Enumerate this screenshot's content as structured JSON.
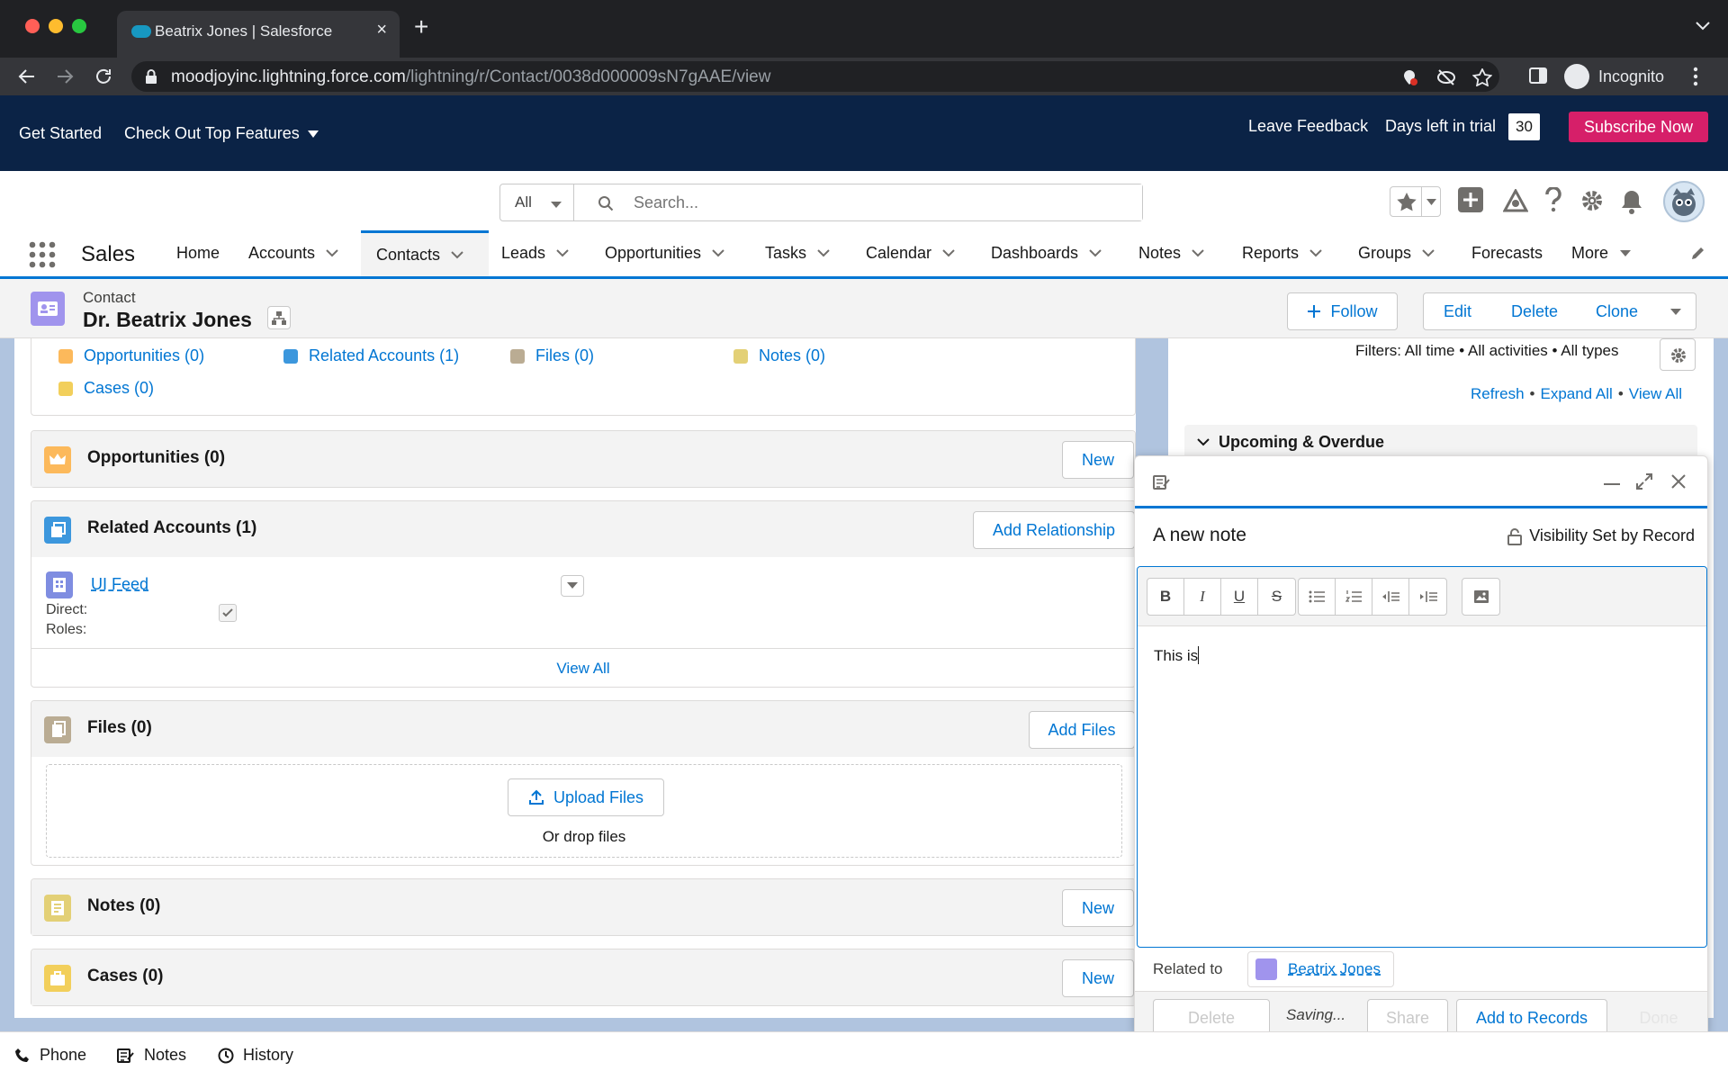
{
  "browser": {
    "tab_title": "Beatrix Jones | Salesforce",
    "url_host": "moodjoyinc.lightning.force.com",
    "url_path": "/lightning/r/Contact/0038d000009sN7gAAE/view",
    "profile_label": "Incognito"
  },
  "banner": {
    "get_started": "Get Started",
    "top_features": "Check Out Top Features",
    "leave_feedback": "Leave Feedback",
    "days_left_label": "Days left in trial",
    "days_left": "30",
    "subscribe": "Subscribe Now"
  },
  "search": {
    "scope": "All",
    "placeholder": "Search..."
  },
  "app": {
    "name": "Sales"
  },
  "nav": {
    "items": [
      {
        "label": "Home",
        "menu": false
      },
      {
        "label": "Accounts",
        "menu": true
      },
      {
        "label": "Contacts",
        "menu": true,
        "active": true
      },
      {
        "label": "Leads",
        "menu": true
      },
      {
        "label": "Opportunities",
        "menu": true
      },
      {
        "label": "Tasks",
        "menu": true
      },
      {
        "label": "Calendar",
        "menu": true
      },
      {
        "label": "Dashboards",
        "menu": true
      },
      {
        "label": "Notes",
        "menu": true
      },
      {
        "label": "Reports",
        "menu": true
      },
      {
        "label": "Groups",
        "menu": true
      },
      {
        "label": "Forecasts",
        "menu": false
      },
      {
        "label": "More",
        "menu": true
      }
    ]
  },
  "record": {
    "type": "Contact",
    "name": "Dr. Beatrix Jones",
    "follow": "Follow",
    "edit": "Edit",
    "delete": "Delete",
    "clone": "Clone"
  },
  "quick_links": {
    "opportunities": "Opportunities (0)",
    "related_accounts": "Related Accounts (1)",
    "files": "Files (0)",
    "notes": "Notes (0)",
    "cases": "Cases (0)"
  },
  "cards": {
    "opportunities": {
      "title": "Opportunities (0)",
      "action": "New"
    },
    "related_accounts": {
      "title": "Related Accounts (1)",
      "action": "Add Relationship",
      "account_name": "UI Feed",
      "direct_label": "Direct:",
      "roles_label": "Roles:",
      "view_all": "View All"
    },
    "files": {
      "title": "Files (0)",
      "action": "Add Files",
      "upload": "Upload Files",
      "drop": "Or drop files"
    },
    "notes": {
      "title": "Notes (0)",
      "action": "New"
    },
    "cases": {
      "title": "Cases (0)",
      "action": "New"
    }
  },
  "activity": {
    "filters": "Filters: All time • All activities • All types",
    "refresh": "Refresh",
    "expand_all": "Expand All",
    "view_all": "View All",
    "upcoming": "Upcoming & Overdue"
  },
  "composer": {
    "note_title": "A new note",
    "visibility": "Visibility Set by Record",
    "body": "This is",
    "related_label": "Related to",
    "related_record": "Beatrix Jones",
    "delete": "Delete",
    "status": "Saving...",
    "share": "Share",
    "add_to_records": "Add to Records",
    "done": "Done",
    "toolbar": [
      "B",
      "I",
      "U",
      "S"
    ]
  },
  "utility": {
    "phone": "Phone",
    "notes": "Notes",
    "history": "History"
  },
  "colors": {
    "brand_blue": "#0176d3",
    "banner_navy": "#0b2346",
    "subscribe_pink": "#d61f69",
    "contact_purple": "#a094ed"
  }
}
